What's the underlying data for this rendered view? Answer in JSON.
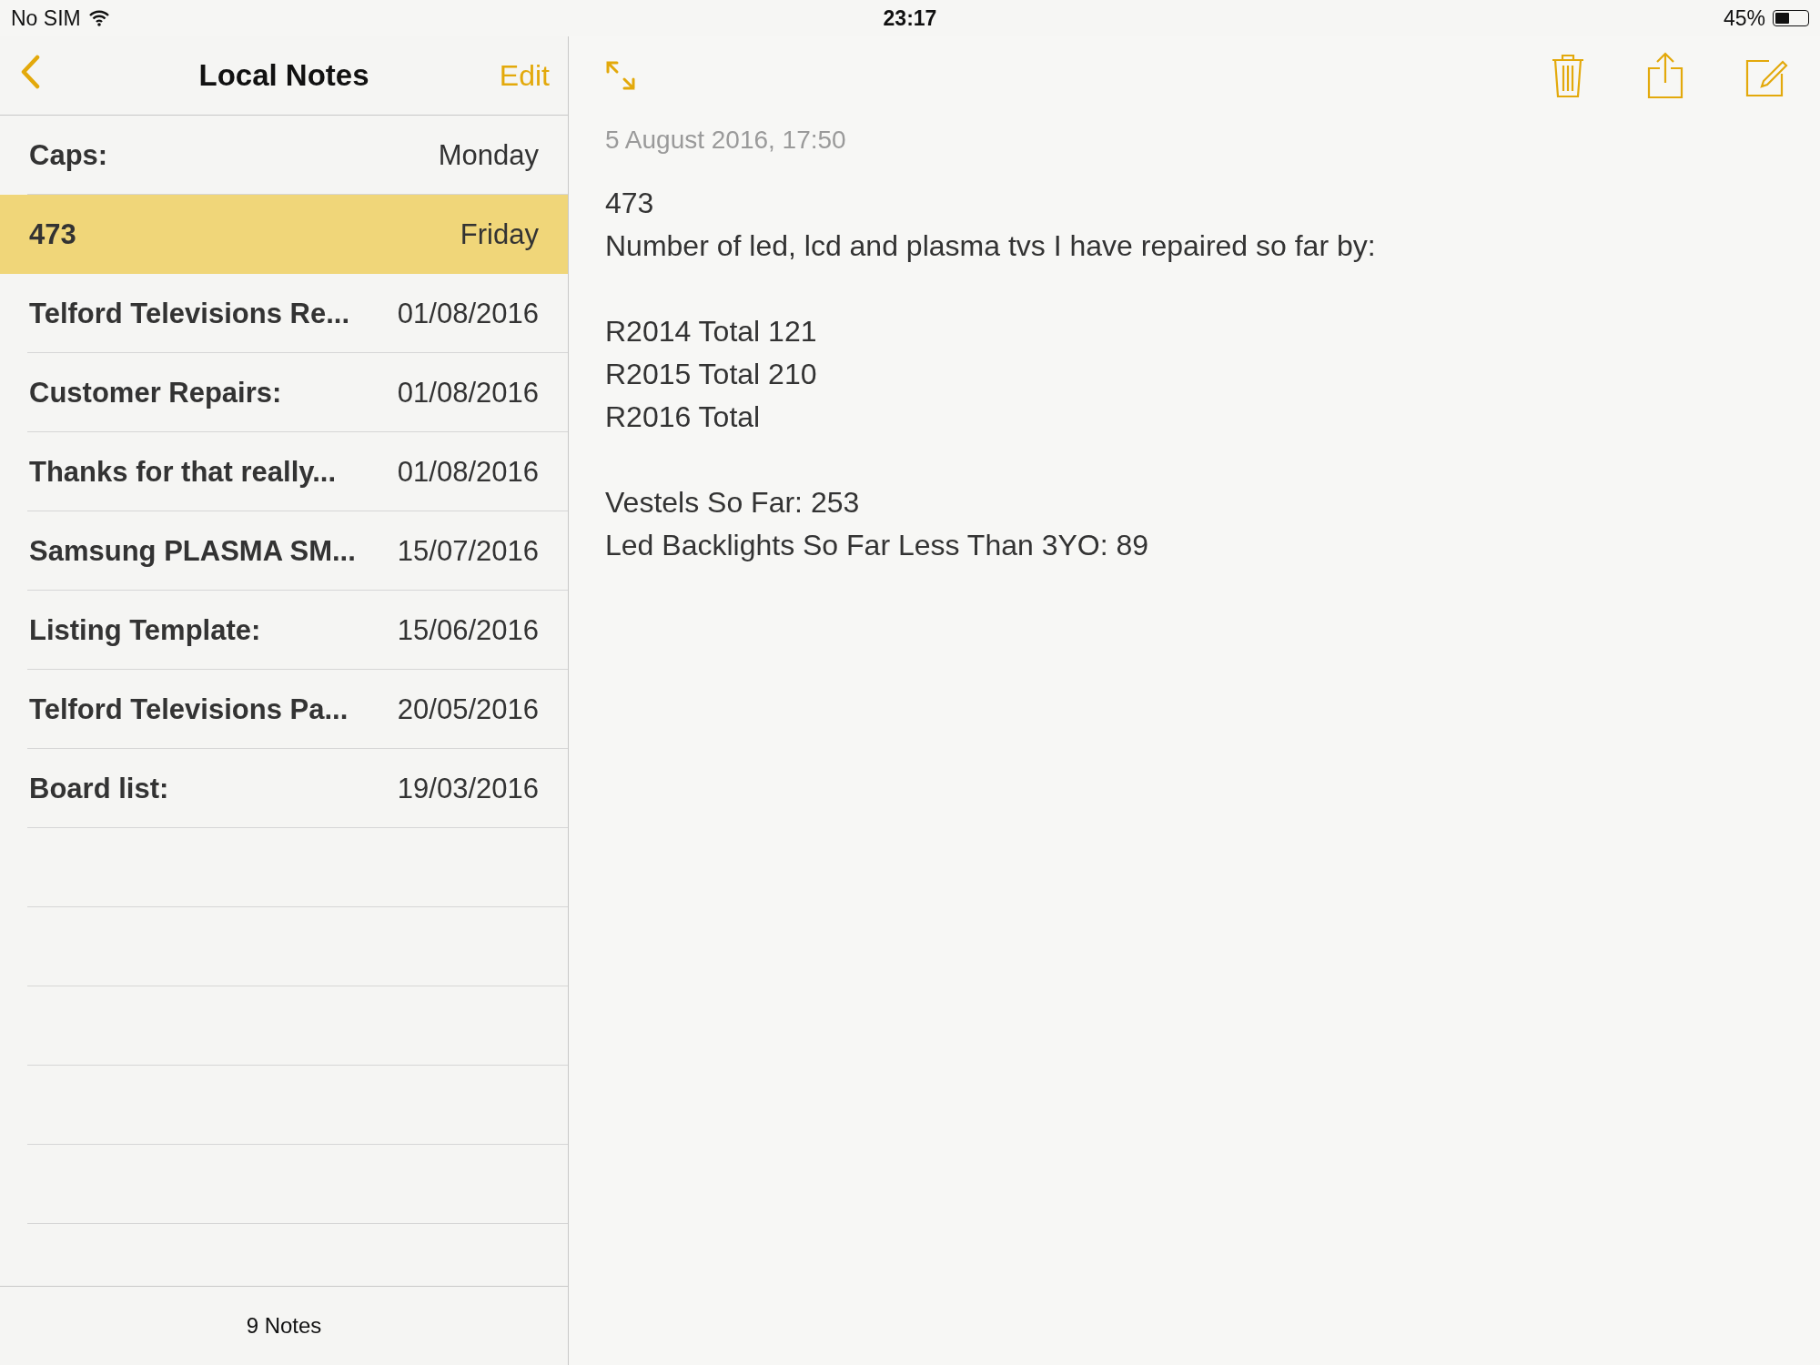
{
  "status_bar": {
    "carrier": "No SIM",
    "time": "23:17",
    "battery": "45%"
  },
  "sidebar": {
    "title": "Local Notes",
    "back_button": true,
    "edit_button": "Edit",
    "notes": [
      {
        "title": "Caps:",
        "date": "Monday",
        "selected": false
      },
      {
        "title": "473",
        "date": "Friday",
        "selected": true
      },
      {
        "title": "Telford Televisions Re...",
        "date": "01/08/2016",
        "selected": false
      },
      {
        "title": "Customer Repairs:",
        "date": "01/08/2016",
        "selected": false
      },
      {
        "title": "Thanks for that  really...",
        "date": "01/08/2016",
        "selected": false
      },
      {
        "title": "Samsung PLASMA SM...",
        "date": "15/07/2016",
        "selected": false
      },
      {
        "title": "Listing Template:",
        "date": "15/06/2016",
        "selected": false
      },
      {
        "title": "Telford Televisions Pa...",
        "date": "20/05/2016",
        "selected": false
      },
      {
        "title": "Board list:",
        "date": "19/03/2016",
        "selected": false
      }
    ],
    "footer": "9 Notes"
  },
  "note": {
    "timestamp": "5 August 2016, 17:50",
    "paragraphs": [
      [
        "473",
        "Number of led, lcd and plasma tvs I have repaired so far by:"
      ],
      [
        "R2014 Total 121",
        "R2015 Total 210",
        "R2016 Total"
      ],
      [
        "Vestels So Far: 253",
        "Led Backlights So Far Less Than 3YO: 89"
      ]
    ]
  }
}
